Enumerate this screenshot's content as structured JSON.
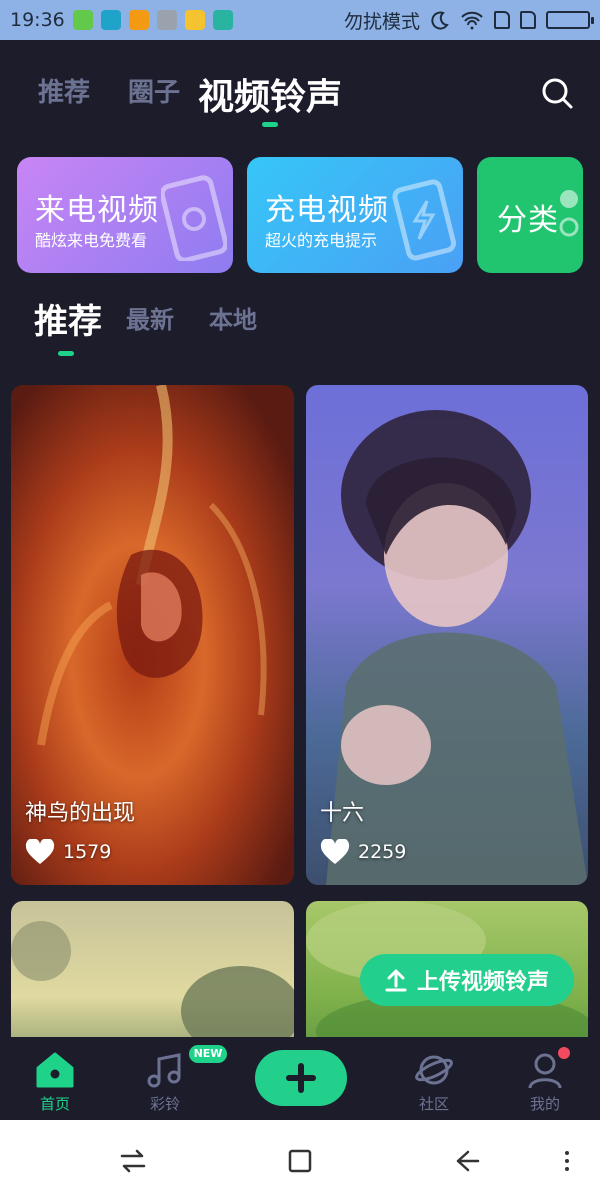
{
  "status_bar": {
    "time": "19:36",
    "dnd_text": "勿扰模式",
    "app_icon_colors": [
      "#62c94a",
      "#1fa3c8",
      "#f39a12",
      "#9aa3ad",
      "#f5c230",
      "#2ab3a0"
    ]
  },
  "top_tabs": {
    "items": [
      "推荐",
      "圈子",
      "视频铃声"
    ],
    "active": "视频铃声"
  },
  "categories": [
    {
      "title": "来电视频",
      "subtitle": "酷炫来电免费看"
    },
    {
      "title": "充电视频",
      "subtitle": "超火的充电提示"
    },
    {
      "title": "分类",
      "subtitle": ""
    }
  ],
  "sub_tabs": {
    "items": [
      "推荐",
      "最新",
      "本地"
    ],
    "active": "推荐"
  },
  "videos": [
    {
      "title": "神鸟的出现",
      "likes": "1579"
    },
    {
      "title": "十六",
      "likes": "2259"
    }
  ],
  "upload_button": {
    "label": "上传视频铃声"
  },
  "bottom_nav": {
    "items": [
      {
        "label": "首页",
        "icon": "home-icon",
        "active": true
      },
      {
        "label": "彩铃",
        "icon": "music-note-icon",
        "badge": "NEW"
      },
      {
        "label": "",
        "icon": "plus-icon"
      },
      {
        "label": "社区",
        "icon": "planet-icon"
      },
      {
        "label": "我的",
        "icon": "user-icon",
        "notification_dot": true
      }
    ]
  },
  "colors": {
    "accent": "#1ed28a",
    "background": "#1d1c2b",
    "inactive_text": "#6c7291",
    "notification": "#f24a5e"
  }
}
